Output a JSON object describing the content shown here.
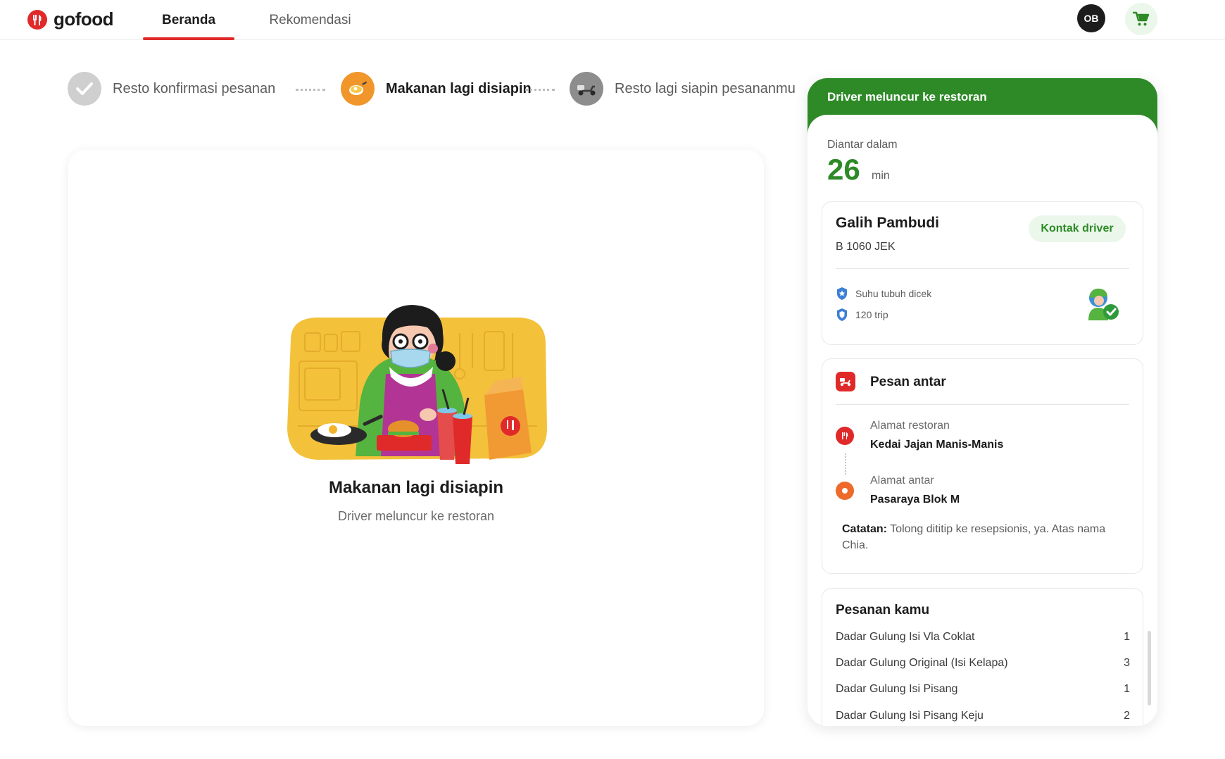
{
  "header": {
    "brand": "gofood",
    "tabs": [
      {
        "label": "Beranda",
        "active": true
      },
      {
        "label": "Rekomendasi",
        "active": false
      }
    ],
    "avatar_initials": "OB",
    "cart_icon": "cart-icon"
  },
  "steps": [
    {
      "label": "Resto konfirmasi pesanan",
      "state": "done",
      "icon": "check-icon"
    },
    {
      "label": "Makanan lagi disiapin",
      "state": "current",
      "icon": "cooking-pan-icon"
    },
    {
      "label": "Resto lagi siapin pesananmu",
      "state": "pending",
      "icon": "scooter-icon"
    }
  ],
  "main": {
    "title": "Makanan lagi disiapin",
    "subtitle": "Driver meluncur ke restoran",
    "illustration": "chef-cooking-illustration"
  },
  "panel": {
    "status": "Driver meluncur ke restoran",
    "eta_label": "Diantar dalam",
    "eta_value": "26",
    "eta_unit": "min",
    "driver": {
      "name": "Galih Pambudi",
      "plate": "B 1060 JEK",
      "contact_label": "Kontak driver",
      "badges": [
        {
          "icon": "shield-star-icon",
          "text": "Suhu tubuh dicek"
        },
        {
          "icon": "shield-icon",
          "text": "120 trip"
        }
      ]
    },
    "delivery": {
      "title": "Pesan antar",
      "restaurant_label": "Alamat restoran",
      "restaurant_value": "Kedai Jajan Manis-Manis",
      "dest_label": "Alamat antar",
      "dest_value": "Pasaraya Blok M",
      "note_label": "Catatan:",
      "note_text": "Tolong dititip ke resepsionis, ya. Atas nama Chia."
    },
    "order": {
      "title": "Pesanan kamu",
      "items": [
        {
          "name": "Dadar Gulung Isi Vla Coklat",
          "qty": "1"
        },
        {
          "name": "Dadar Gulung Original (Isi Kelapa)",
          "qty": "3"
        },
        {
          "name": "Dadar Gulung Isi Pisang",
          "qty": "1"
        },
        {
          "name": "Dadar Gulung Isi Pisang Keju",
          "qty": "2"
        }
      ]
    }
  },
  "colors": {
    "brand_red": "#e02a2a",
    "go_green": "#2e8a27",
    "step_orange": "#f0962a"
  }
}
